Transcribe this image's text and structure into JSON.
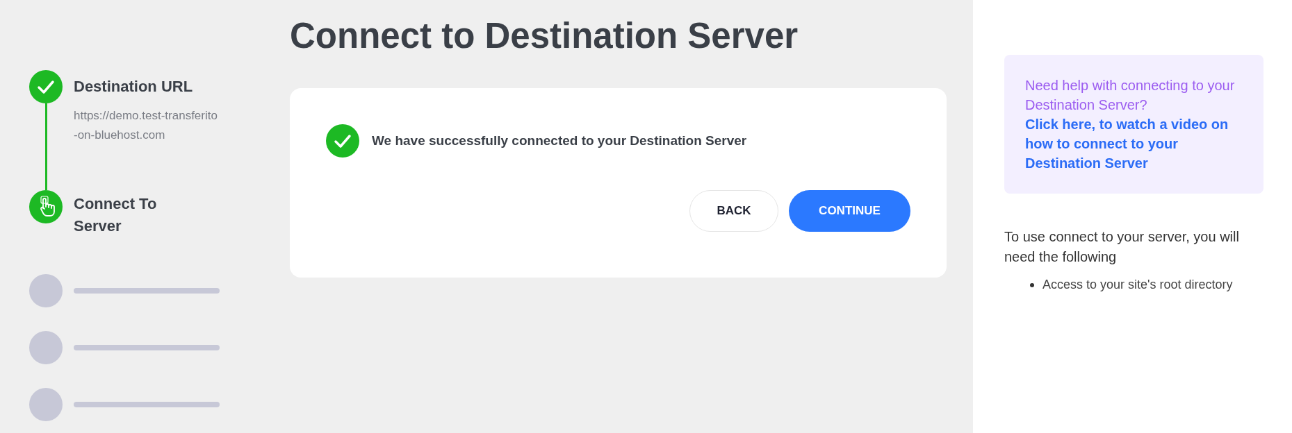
{
  "title": "Connect to Destination Server",
  "steps": [
    {
      "kind": "done",
      "label": "Destination URL",
      "detail": "https://demo.test-transferito-on-bluehost.com"
    },
    {
      "kind": "current",
      "label": "Connect To Server"
    },
    {
      "kind": "pending"
    },
    {
      "kind": "pending"
    },
    {
      "kind": "pending"
    }
  ],
  "card": {
    "message": "We have successfully connected to your Destination Server",
    "buttons": [
      {
        "kind": "secondary",
        "label": "BACK"
      },
      {
        "kind": "primary",
        "label": "CONTINUE"
      }
    ]
  },
  "help": {
    "question": "Need help with connecting to your Destination Server?",
    "link": "Click here, to watch a video on how to connect to your Destination Server"
  },
  "requirements": {
    "intro": "To use connect to your server, you will need the following",
    "items": [
      "Access to your site's root directory"
    ]
  }
}
